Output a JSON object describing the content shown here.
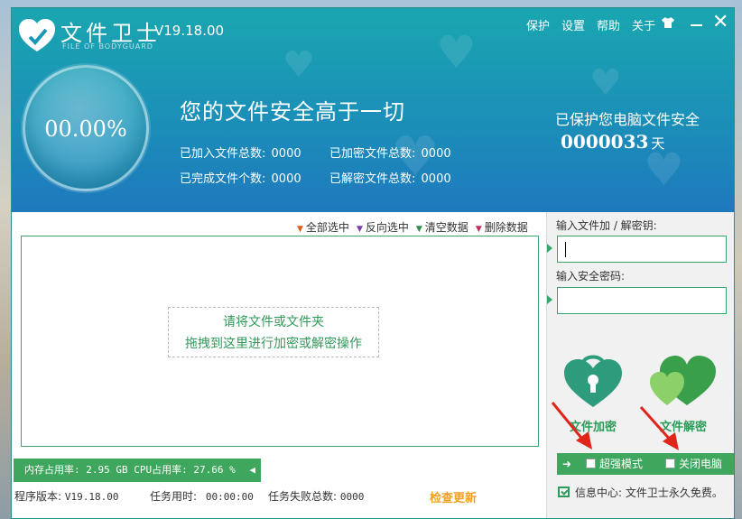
{
  "app": {
    "title": "文件卫士",
    "subtitle": "FILE OF BODYGUARD",
    "version": "V19.18.00"
  },
  "topmenu": {
    "items": [
      "保护",
      "设置",
      "帮助",
      "关于"
    ],
    "skin_icon": "shirt-icon",
    "minimize_icon": "minimize-icon",
    "close_icon": "close-icon",
    "close_glyph": "✕"
  },
  "dashboard": {
    "progress": "00.00%",
    "slogan": "您的文件安全高于一切",
    "stats": [
      {
        "label": "已加入文件总数:",
        "value": "0000"
      },
      {
        "label": "已加密文件总数:",
        "value": "0000"
      },
      {
        "label": "已完成文件个数:",
        "value": "0000"
      },
      {
        "label": "已解密文件总数:",
        "value": "0000"
      }
    ],
    "protect_label": "已保护您电脑文件安全",
    "protect_days": "0000033",
    "protect_unit": "天"
  },
  "actions": {
    "select_all": "全部选中",
    "invert": "反向选中",
    "clear": "清空数据",
    "delete": "删除数据",
    "colors": {
      "select_all": "#e05a1c",
      "invert": "#7a3ab0",
      "clear": "#2e8a4a",
      "delete": "#c0305a"
    }
  },
  "dropzone": {
    "line1": "请将文件或文件夹",
    "line2": "拖拽到这里进行加密或解密操作"
  },
  "sysbar": {
    "text": "内存占用率: 2.95 GB  CPU占用率: 27.66 %",
    "back_glyph": "◀"
  },
  "status": {
    "version_label": "程序版本:",
    "version_value": "V19.18.00",
    "time_label": "任务用时:",
    "time_value": "00:00:00",
    "fail_label": "任务失败总数:",
    "fail_value": "0000",
    "update": "检查更新"
  },
  "right": {
    "key_label": "输入文件加 / 解密钥:",
    "key_value": "",
    "pwd_label": "输入安全密码:",
    "pwd_value": "",
    "encrypt_label": "文件加密",
    "decrypt_label": "文件解密",
    "super_mode": "超强模式",
    "shutdown": "关闭电脑",
    "mode_arrow": "➜",
    "info": "信息中心: 文件卫士永久免费。"
  },
  "colors": {
    "header_top": "#1aa6b0",
    "header_bottom": "#1f79bd",
    "accent_green": "#3fa65d",
    "update_orange": "#f0a020",
    "arrow_red": "#e0251b"
  }
}
